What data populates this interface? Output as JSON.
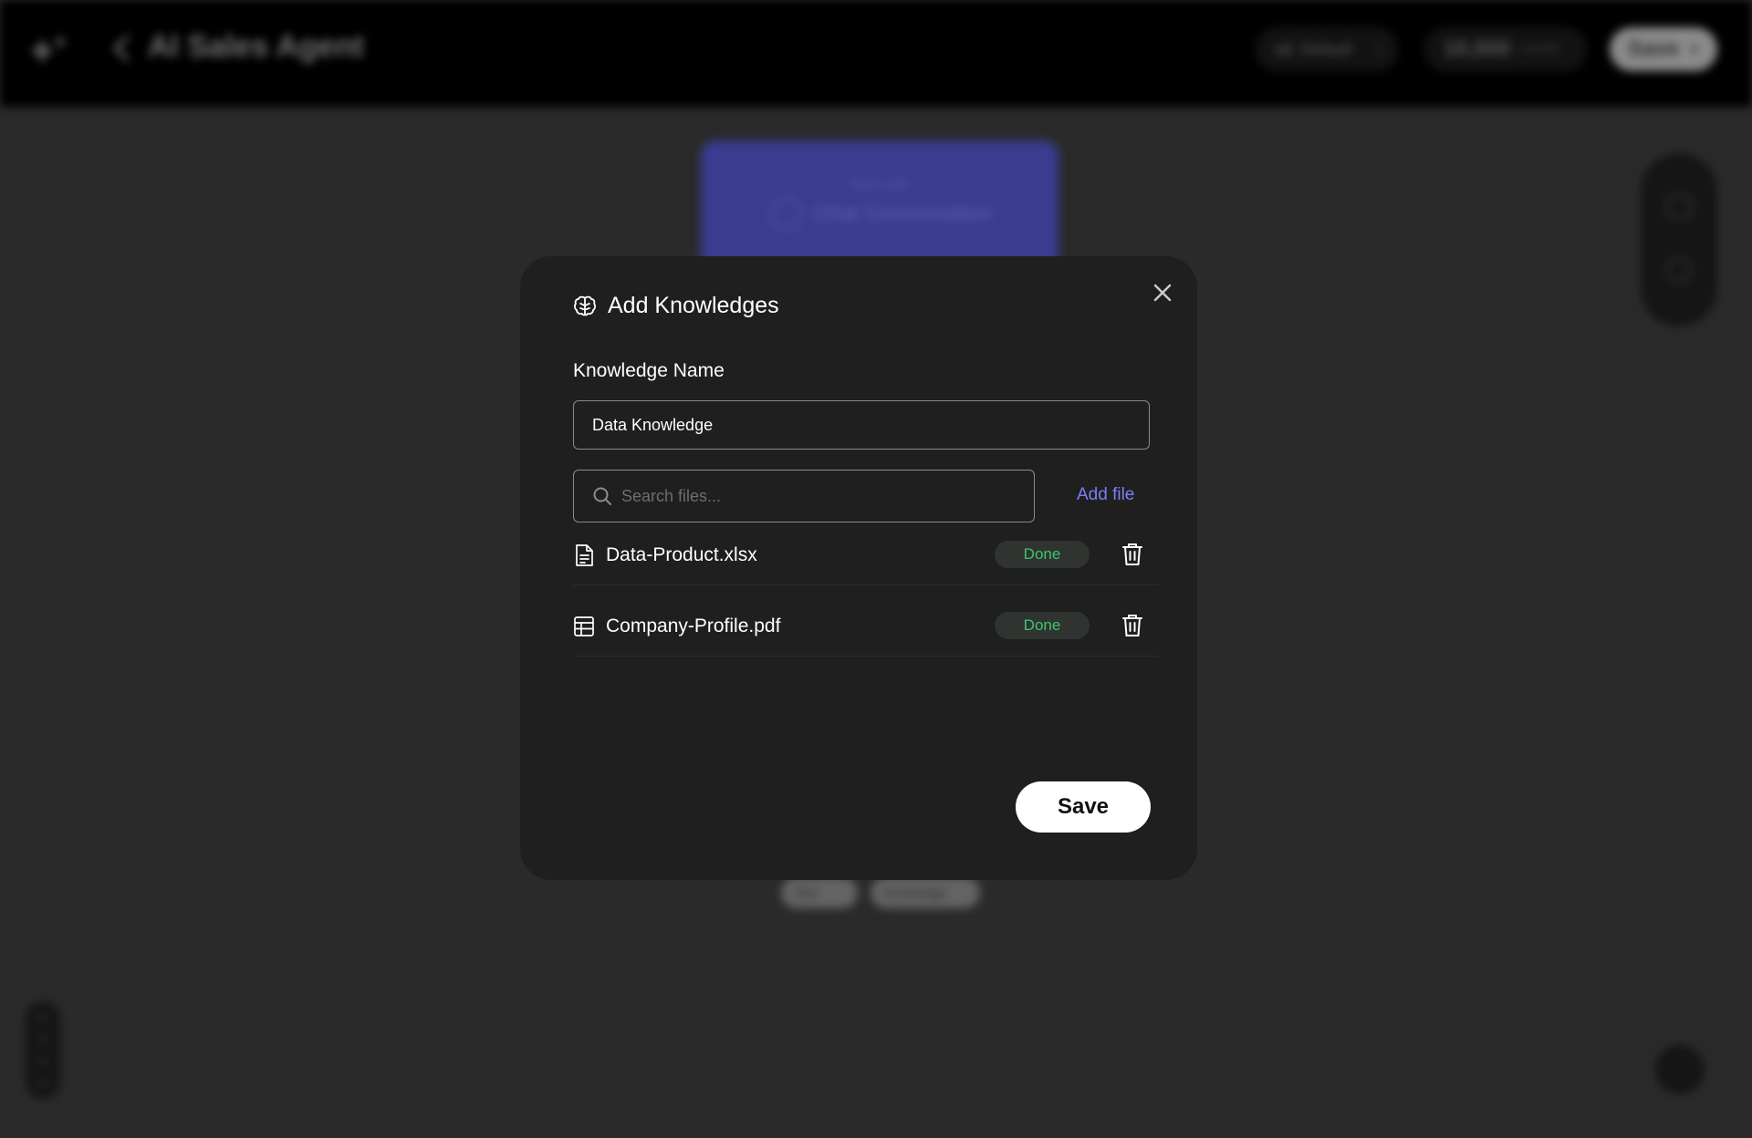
{
  "topbar": {
    "title": "AI Sales Agent",
    "version": "v1",
    "version_label": "Default",
    "credits_value": "10,000",
    "credits_unit": "credits",
    "save_label": "Save"
  },
  "canvas": {
    "start_node": {
      "subtitle": "Start with",
      "label": "Chat Conversation"
    },
    "chips": [
      {
        "label": "Text"
      },
      {
        "label": "Knowledge"
      }
    ]
  },
  "modal": {
    "title": "Add Knowledges",
    "name_label": "Knowledge Name",
    "name_value": "Data Knowledge",
    "search_placeholder": "Search files...",
    "add_file_label": "Add file",
    "files": [
      {
        "name": "Data-Product.xlsx",
        "icon": "document-icon",
        "status": "Done"
      },
      {
        "name": "Company-Profile.pdf",
        "icon": "table-icon",
        "status": "Done"
      }
    ],
    "save_label": "Save"
  },
  "colors": {
    "accent": "#7b7ef7",
    "status_done": "#3ec46d",
    "start_node": "#4848b0",
    "modal_bg": "#1f1f1f"
  }
}
